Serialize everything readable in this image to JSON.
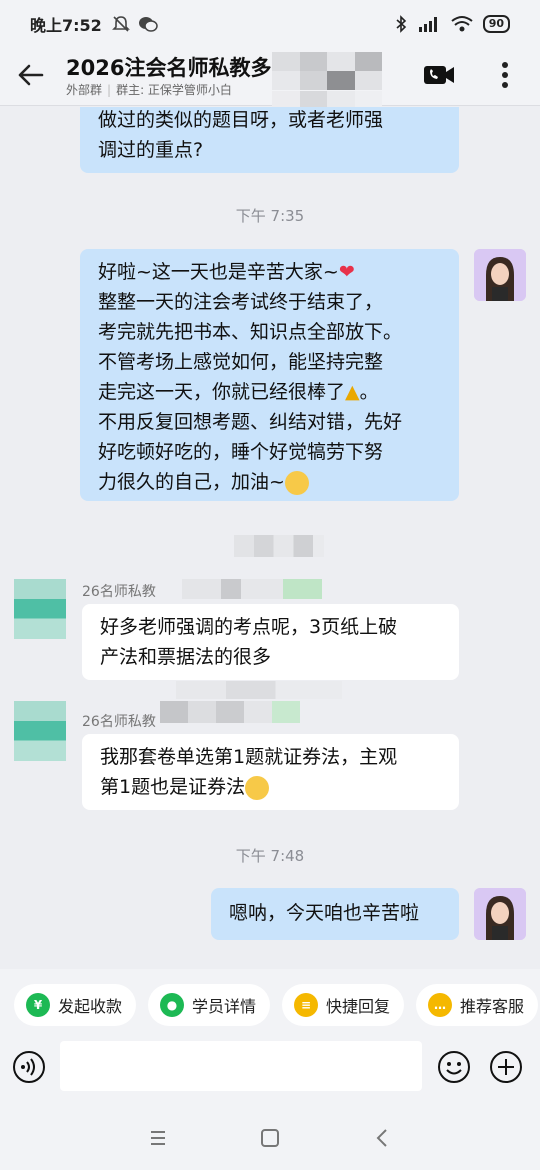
{
  "status_bar": {
    "time": "晚上7:52",
    "battery": "90",
    "icons": [
      "bell-muted-icon",
      "wechat-icon",
      "bluetooth-icon",
      "hd-signal-icon",
      "wifi-icon",
      "battery-icon"
    ]
  },
  "header": {
    "title": "2026注会名师私教多",
    "subtitle_left": "外部群",
    "subtitle_right": "群主: 正保学管师小白",
    "icons": [
      "back-arrow-icon",
      "video-call-icon",
      "more-vertical-icon"
    ]
  },
  "messages": {
    "m1": {
      "lines": [
        "做过的类似的题目呀，或者老师强",
        "调过的重点?"
      ]
    },
    "t1": "下午 7:35",
    "m2": {
      "lines": [
        "好啦~这一天也是辛苦大家~",
        "整整一天的注会考试终于结束了，",
        "考完就先把书本、知识点全部放下。",
        "不管考场上感觉如何，能坚持完整",
        "走完这一天，你就已经很棒了",
        "不用反复回想考题、纠结对错，先好",
        "好吃顿好吃的，睡个好觉犒劳下努",
        "力很久的自己，加油~"
      ]
    },
    "m3": {
      "sender": "26名师私教",
      "lines": [
        "好多老师强调的考点呢，3页纸上破",
        "产法和票据法的很多"
      ]
    },
    "m4": {
      "sender": "26名师私教",
      "lines": [
        "我那套卷单选第1题就证券法，主观",
        "第1题也是证券法"
      ]
    },
    "t2": "下午 7:48",
    "m5": {
      "lines": [
        "嗯呐，今天咱也辛苦啦"
      ]
    }
  },
  "quick_replies": [
    {
      "label": "发起收款",
      "icon": "payment-icon",
      "color": "#1db954"
    },
    {
      "label": "学员详情",
      "icon": "student-icon",
      "color": "#1db954"
    },
    {
      "label": "快捷回复",
      "icon": "quick-reply-icon",
      "color": "#f5b800"
    },
    {
      "label": "推荐客服",
      "icon": "recommend-icon",
      "color": "#f5b800"
    }
  ],
  "input": {
    "placeholder": ""
  },
  "colors": {
    "bubble_out": "#c9e3fb",
    "bubble_in": "#ffffff",
    "background": "#edeef2"
  }
}
